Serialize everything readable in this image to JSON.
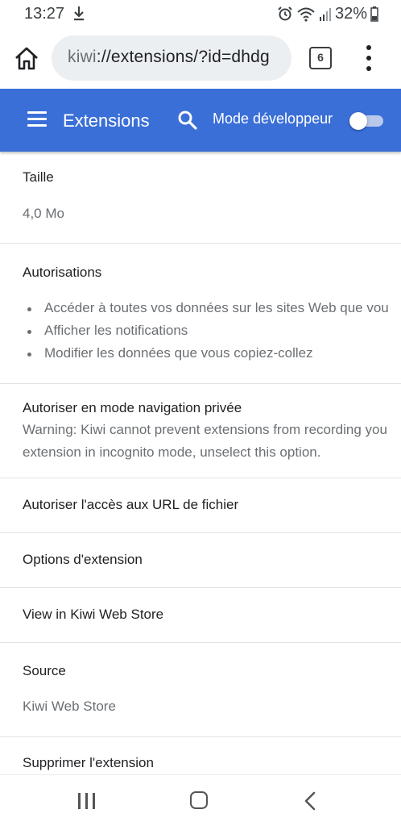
{
  "status_bar": {
    "time": "13:27",
    "battery_percent": "32%",
    "icons": [
      "download-icon",
      "alarm-icon",
      "wifi-icon",
      "signal-icon",
      "battery-icon"
    ]
  },
  "browser": {
    "url_scheme": "kiwi",
    "url_rest": "://extensions/?id=dhdg",
    "tab_count": "6"
  },
  "header": {
    "title": "Extensions",
    "dev_mode_label": "Mode développeur",
    "dev_mode_on": false,
    "color": "#3b6fd8"
  },
  "details": {
    "size_label": "Taille",
    "size_value": "4,0 Mo",
    "permissions_label": "Autorisations",
    "permissions": [
      "Accéder à toutes vos données sur les sites Web que vou",
      "Afficher les notifications",
      "Modifier les données que vous copiez-collez"
    ],
    "incognito_label": "Autoriser en mode navigation privée",
    "incognito_warning_line1": "Warning: Kiwi cannot prevent extensions from recording you",
    "incognito_warning_line2": "extension in incognito mode, unselect this option.",
    "file_urls_label": "Autoriser l'accès aux URL de fichier",
    "options_label": "Options d'extension",
    "store_label": "View in Kiwi Web Store",
    "source_label": "Source",
    "source_value": "Kiwi Web Store",
    "remove_label": "Supprimer l'extension"
  }
}
